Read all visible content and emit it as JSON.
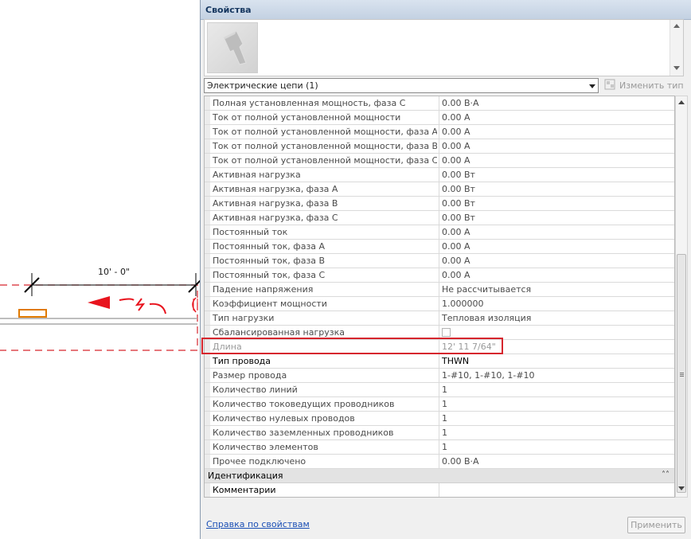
{
  "canvas": {
    "dimension_text": "10' - 0\"",
    "colors": {
      "dashed_boundary": "#d6262e",
      "wire": "#b0b0b0",
      "tag": "#e07a00",
      "arrow": "#e8141e"
    }
  },
  "palette": {
    "title": "Свойства",
    "type_selector": {
      "value": "Электрические цепи (1)"
    },
    "edit_type_label": "Изменить тип",
    "rows": [
      {
        "name": "Полная установленная мощность, фаза C",
        "value": "0.00 В·А"
      },
      {
        "name": "Ток от полной установленной мощности",
        "value": "0.00 A"
      },
      {
        "name": "Ток от полной установленной мощности, фаза A",
        "value": "0.00 A"
      },
      {
        "name": "Ток от полной установленной мощности, фаза B",
        "value": "0.00 A"
      },
      {
        "name": "Ток от полной установленной мощности, фаза C",
        "value": "0.00 A"
      },
      {
        "name": "Активная нагрузка",
        "value": "0.00 Вт"
      },
      {
        "name": "Активная нагрузка, фаза A",
        "value": "0.00 Вт"
      },
      {
        "name": "Активная нагрузка, фаза B",
        "value": "0.00 Вт"
      },
      {
        "name": "Активная нагрузка, фаза C",
        "value": "0.00 Вт"
      },
      {
        "name": "Постоянный ток",
        "value": "0.00 A"
      },
      {
        "name": "Постоянный ток, фаза A",
        "value": "0.00 A"
      },
      {
        "name": "Постоянный ток, фаза B",
        "value": "0.00 A"
      },
      {
        "name": "Постоянный ток, фаза C",
        "value": "0.00 A"
      },
      {
        "name": "Падение напряжения",
        "value": "Не рассчитывается"
      },
      {
        "name": "Коэффициент мощности",
        "value": "1.000000"
      },
      {
        "name": "Тип нагрузки",
        "value": "Тепловая изоляция"
      },
      {
        "name": "Сбалансированная нагрузка",
        "value": "",
        "checkbox": true,
        "checked": false
      },
      {
        "name": "Длина",
        "value": "12'  11 7/64\"",
        "disabled": true
      },
      {
        "name": "Тип провода",
        "value": "THWN",
        "strong": true
      },
      {
        "name": "Размер провода",
        "value": "1-#10, 1-#10, 1-#10"
      },
      {
        "name": "Количество линий",
        "value": "1"
      },
      {
        "name": "Количество токоведущих проводников",
        "value": "1"
      },
      {
        "name": "Количество нулевых проводов",
        "value": "1"
      },
      {
        "name": "Количество заземленных проводников",
        "value": "1"
      },
      {
        "name": "Количество элементов",
        "value": "1"
      },
      {
        "name": "Прочее подключено",
        "value": "0.00 В·А"
      }
    ],
    "group": {
      "name": "Идентификация"
    },
    "group_rows": [
      {
        "name": "Комментарии",
        "value": "",
        "strong": true
      }
    ],
    "help_link": "Справка по свойствам",
    "apply_button": "Применить",
    "highlight_color": "#d6262e"
  }
}
